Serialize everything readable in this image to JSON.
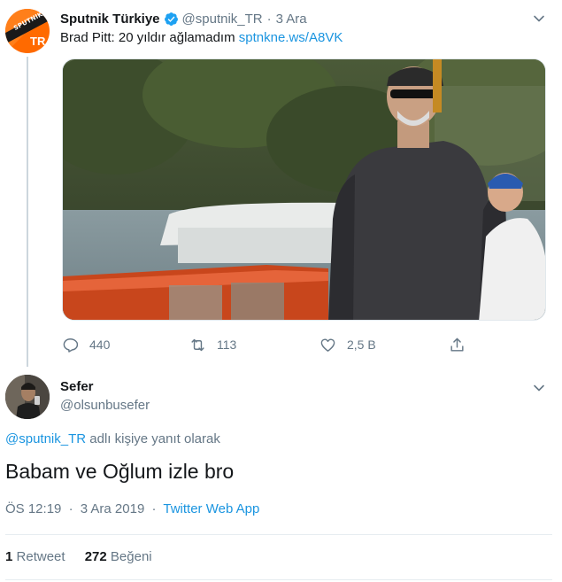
{
  "parent_tweet": {
    "author": {
      "display_name": "Sputnik Türkiye",
      "handle": "@sputnik_TR",
      "verified": true,
      "avatar_brand": "SPUTNIK",
      "avatar_tag": "TR"
    },
    "separator": "·",
    "timestamp": "3 Ara",
    "text": "Brad Pitt: 20 yıldır ağlamadım",
    "link": "sptnkne.ws/A8VK",
    "actions": {
      "reply_count": "440",
      "retweet_count": "113",
      "like_count": "2,5 B"
    }
  },
  "reply_tweet": {
    "author": {
      "display_name": "Sefer",
      "handle": "@olsunbusefer"
    },
    "reply_context": {
      "mention": "@sputnik_TR",
      "suffix": " adlı kişiye yanıt olarak"
    },
    "text": "Babam ve Oğlum izle bro",
    "meta": {
      "time": "ÖS 12:19",
      "separator": "·",
      "date": "3 Ara 2019",
      "source": "Twitter Web App"
    },
    "stats": {
      "retweets": "1",
      "retweets_label": "Retweet",
      "likes": "272",
      "likes_label": "Beğeni"
    }
  },
  "colors": {
    "accent": "#1b95e0",
    "muted": "#657786",
    "text": "#14171a",
    "verified": "#1da1f2",
    "sputnik_orange": "#ff6a00"
  }
}
